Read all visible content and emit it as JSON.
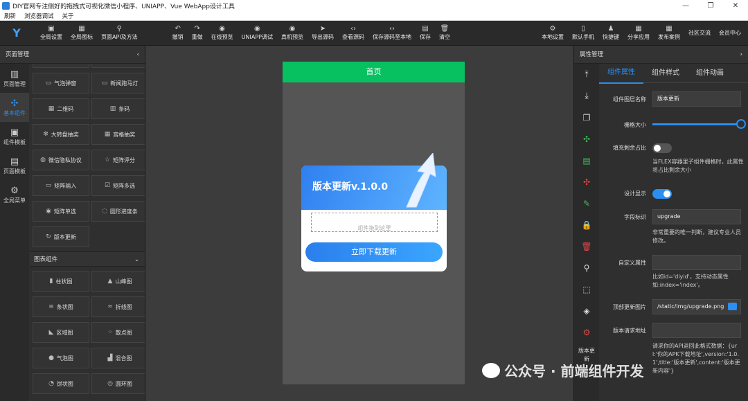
{
  "window": {
    "title": "DIY官网专注侧好的拖拽式可视化微信小程序、UNIAPP、Vue WebApp设计工具"
  },
  "menu": [
    "刷新",
    "浏览器调试",
    "关于"
  ],
  "toolbar": {
    "left": [
      {
        "label": "全局设置",
        "icon": "settings-icon"
      },
      {
        "label": "全局图标",
        "icon": "image-icon"
      },
      {
        "label": "页面API及方法",
        "icon": "link-icon"
      },
      {
        "label": "撤销",
        "icon": "undo-icon"
      },
      {
        "label": "重做",
        "icon": "redo-icon"
      },
      {
        "label": "在线预览",
        "icon": "eye-icon"
      },
      {
        "label": "UNIAPP调试",
        "icon": "eye-icon"
      },
      {
        "label": "真机预览",
        "icon": "eye-icon"
      },
      {
        "label": "导出源码",
        "icon": "send-icon"
      },
      {
        "label": "查看源码",
        "icon": "code-icon"
      },
      {
        "label": "保存源码至本地",
        "icon": "code-icon"
      },
      {
        "label": "保存",
        "icon": "save-icon"
      },
      {
        "label": "清空",
        "icon": "trash-icon"
      }
    ],
    "right": [
      {
        "label": "本地设置",
        "icon": "gear-icon"
      },
      {
        "label": "默认手机",
        "icon": "phone-icon"
      },
      {
        "label": "快捷键",
        "icon": "user-icon"
      },
      {
        "label": "分享应用",
        "icon": "grid-icon"
      },
      {
        "label": "发布案例",
        "icon": "grid-icon"
      },
      {
        "label": "社区交流",
        "icon": ""
      },
      {
        "label": "会员中心",
        "icon": ""
      }
    ]
  },
  "left_panel": {
    "title": "页面管理",
    "nav": [
      {
        "label": "页面管理",
        "icon": "layout-icon"
      },
      {
        "label": "基本组件",
        "icon": "puzzle-icon"
      },
      {
        "label": "组件模板",
        "icon": "template-icon"
      },
      {
        "label": "页面模板",
        "icon": "page-icon"
      },
      {
        "label": "全局菜单",
        "icon": "gear-icon"
      }
    ],
    "components": [
      [
        "气泡弹窗",
        "新闻跑马灯"
      ],
      [
        "二维码",
        "条码"
      ],
      [
        "大转盘抽奖",
        "宫格抽奖"
      ],
      [
        "微信隐私协议",
        "矩阵评分"
      ],
      [
        "矩阵输入",
        "矩阵多选"
      ],
      [
        "矩阵单选",
        "圆形进度条"
      ],
      [
        "版本更新",
        ""
      ]
    ],
    "chart_section": "图表组件",
    "charts": [
      [
        "柱状图",
        "山峰图"
      ],
      [
        "条状图",
        "折线图"
      ],
      [
        "区域图",
        "散点图"
      ],
      [
        "气泡图",
        "混合图"
      ],
      [
        "饼状图",
        "圆环图"
      ]
    ]
  },
  "phone": {
    "header": "首页",
    "card_title": "版本更新v.1.0.0",
    "drop_hint": "组件拖到这里",
    "button": "立即下载更新",
    "header_color": "#07c160"
  },
  "right_panel": {
    "title": "属性管理",
    "tabs": [
      "组件属性",
      "组件样式",
      "组件动画"
    ],
    "tools_label": "版本更新",
    "props": {
      "layer_name_label": "组件图层名称",
      "layer_name_value": "版本更新",
      "grid_size_label": "栅格大小",
      "fill_label": "填充剩余占比",
      "fill_note": "当FLEX容器里子组件栅格时，此属性将占比剩余大小",
      "design_label": "设计显示",
      "field_label": "字段标识",
      "field_value": "upgrade",
      "field_note": "非常重要的唯一判断，建议专业人员修改。",
      "custom_label": "自定义属性",
      "custom_note": "比如id='diyid'，支持动态属性如:index='index'。",
      "img_label": "顶部更新图片",
      "img_value": "/static/img/upgrade.png",
      "req_label": "版本请求地址",
      "req_note": "请求你的API返回此格式数据：{url:'你的APK下载地址',version:'1.0.1',title:'版本更新',content:'版本更新内容'}"
    }
  },
  "watermark": "公众号 · 前端组件开发"
}
